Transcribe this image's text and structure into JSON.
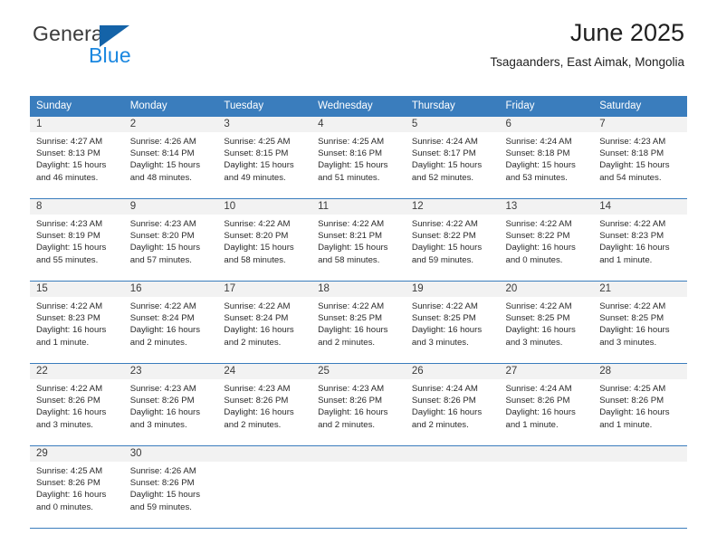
{
  "brand": {
    "name_top": "General",
    "name_bottom": "Blue",
    "triangle_color": "#1463a8",
    "blue_color": "#1a87e0"
  },
  "header": {
    "title": "June 2025",
    "subtitle": "Tsagaanders, East Aimak, Mongolia"
  },
  "theme": {
    "header_blue": "#3a7dbd",
    "daynum_band": "#f2f2f2",
    "text": "#2a2a2a"
  },
  "weekdays": [
    "Sunday",
    "Monday",
    "Tuesday",
    "Wednesday",
    "Thursday",
    "Friday",
    "Saturday"
  ],
  "weeks": [
    [
      {
        "day": "1",
        "sunrise": "Sunrise: 4:27 AM",
        "sunset": "Sunset: 8:13 PM",
        "daylight1": "Daylight: 15 hours",
        "daylight2": "and 46 minutes."
      },
      {
        "day": "2",
        "sunrise": "Sunrise: 4:26 AM",
        "sunset": "Sunset: 8:14 PM",
        "daylight1": "Daylight: 15 hours",
        "daylight2": "and 48 minutes."
      },
      {
        "day": "3",
        "sunrise": "Sunrise: 4:25 AM",
        "sunset": "Sunset: 8:15 PM",
        "daylight1": "Daylight: 15 hours",
        "daylight2": "and 49 minutes."
      },
      {
        "day": "4",
        "sunrise": "Sunrise: 4:25 AM",
        "sunset": "Sunset: 8:16 PM",
        "daylight1": "Daylight: 15 hours",
        "daylight2": "and 51 minutes."
      },
      {
        "day": "5",
        "sunrise": "Sunrise: 4:24 AM",
        "sunset": "Sunset: 8:17 PM",
        "daylight1": "Daylight: 15 hours",
        "daylight2": "and 52 minutes."
      },
      {
        "day": "6",
        "sunrise": "Sunrise: 4:24 AM",
        "sunset": "Sunset: 8:18 PM",
        "daylight1": "Daylight: 15 hours",
        "daylight2": "and 53 minutes."
      },
      {
        "day": "7",
        "sunrise": "Sunrise: 4:23 AM",
        "sunset": "Sunset: 8:18 PM",
        "daylight1": "Daylight: 15 hours",
        "daylight2": "and 54 minutes."
      }
    ],
    [
      {
        "day": "8",
        "sunrise": "Sunrise: 4:23 AM",
        "sunset": "Sunset: 8:19 PM",
        "daylight1": "Daylight: 15 hours",
        "daylight2": "and 55 minutes."
      },
      {
        "day": "9",
        "sunrise": "Sunrise: 4:23 AM",
        "sunset": "Sunset: 8:20 PM",
        "daylight1": "Daylight: 15 hours",
        "daylight2": "and 57 minutes."
      },
      {
        "day": "10",
        "sunrise": "Sunrise: 4:22 AM",
        "sunset": "Sunset: 8:20 PM",
        "daylight1": "Daylight: 15 hours",
        "daylight2": "and 58 minutes."
      },
      {
        "day": "11",
        "sunrise": "Sunrise: 4:22 AM",
        "sunset": "Sunset: 8:21 PM",
        "daylight1": "Daylight: 15 hours",
        "daylight2": "and 58 minutes."
      },
      {
        "day": "12",
        "sunrise": "Sunrise: 4:22 AM",
        "sunset": "Sunset: 8:22 PM",
        "daylight1": "Daylight: 15 hours",
        "daylight2": "and 59 minutes."
      },
      {
        "day": "13",
        "sunrise": "Sunrise: 4:22 AM",
        "sunset": "Sunset: 8:22 PM",
        "daylight1": "Daylight: 16 hours",
        "daylight2": "and 0 minutes."
      },
      {
        "day": "14",
        "sunrise": "Sunrise: 4:22 AM",
        "sunset": "Sunset: 8:23 PM",
        "daylight1": "Daylight: 16 hours",
        "daylight2": "and 1 minute."
      }
    ],
    [
      {
        "day": "15",
        "sunrise": "Sunrise: 4:22 AM",
        "sunset": "Sunset: 8:23 PM",
        "daylight1": "Daylight: 16 hours",
        "daylight2": "and 1 minute."
      },
      {
        "day": "16",
        "sunrise": "Sunrise: 4:22 AM",
        "sunset": "Sunset: 8:24 PM",
        "daylight1": "Daylight: 16 hours",
        "daylight2": "and 2 minutes."
      },
      {
        "day": "17",
        "sunrise": "Sunrise: 4:22 AM",
        "sunset": "Sunset: 8:24 PM",
        "daylight1": "Daylight: 16 hours",
        "daylight2": "and 2 minutes."
      },
      {
        "day": "18",
        "sunrise": "Sunrise: 4:22 AM",
        "sunset": "Sunset: 8:25 PM",
        "daylight1": "Daylight: 16 hours",
        "daylight2": "and 2 minutes."
      },
      {
        "day": "19",
        "sunrise": "Sunrise: 4:22 AM",
        "sunset": "Sunset: 8:25 PM",
        "daylight1": "Daylight: 16 hours",
        "daylight2": "and 3 minutes."
      },
      {
        "day": "20",
        "sunrise": "Sunrise: 4:22 AM",
        "sunset": "Sunset: 8:25 PM",
        "daylight1": "Daylight: 16 hours",
        "daylight2": "and 3 minutes."
      },
      {
        "day": "21",
        "sunrise": "Sunrise: 4:22 AM",
        "sunset": "Sunset: 8:25 PM",
        "daylight1": "Daylight: 16 hours",
        "daylight2": "and 3 minutes."
      }
    ],
    [
      {
        "day": "22",
        "sunrise": "Sunrise: 4:22 AM",
        "sunset": "Sunset: 8:26 PM",
        "daylight1": "Daylight: 16 hours",
        "daylight2": "and 3 minutes."
      },
      {
        "day": "23",
        "sunrise": "Sunrise: 4:23 AM",
        "sunset": "Sunset: 8:26 PM",
        "daylight1": "Daylight: 16 hours",
        "daylight2": "and 3 minutes."
      },
      {
        "day": "24",
        "sunrise": "Sunrise: 4:23 AM",
        "sunset": "Sunset: 8:26 PM",
        "daylight1": "Daylight: 16 hours",
        "daylight2": "and 2 minutes."
      },
      {
        "day": "25",
        "sunrise": "Sunrise: 4:23 AM",
        "sunset": "Sunset: 8:26 PM",
        "daylight1": "Daylight: 16 hours",
        "daylight2": "and 2 minutes."
      },
      {
        "day": "26",
        "sunrise": "Sunrise: 4:24 AM",
        "sunset": "Sunset: 8:26 PM",
        "daylight1": "Daylight: 16 hours",
        "daylight2": "and 2 minutes."
      },
      {
        "day": "27",
        "sunrise": "Sunrise: 4:24 AM",
        "sunset": "Sunset: 8:26 PM",
        "daylight1": "Daylight: 16 hours",
        "daylight2": "and 1 minute."
      },
      {
        "day": "28",
        "sunrise": "Sunrise: 4:25 AM",
        "sunset": "Sunset: 8:26 PM",
        "daylight1": "Daylight: 16 hours",
        "daylight2": "and 1 minute."
      }
    ],
    [
      {
        "day": "29",
        "sunrise": "Sunrise: 4:25 AM",
        "sunset": "Sunset: 8:26 PM",
        "daylight1": "Daylight: 16 hours",
        "daylight2": "and 0 minutes."
      },
      {
        "day": "30",
        "sunrise": "Sunrise: 4:26 AM",
        "sunset": "Sunset: 8:26 PM",
        "daylight1": "Daylight: 15 hours",
        "daylight2": "and 59 minutes."
      },
      {
        "day": "",
        "sunrise": "",
        "sunset": "",
        "daylight1": "",
        "daylight2": ""
      },
      {
        "day": "",
        "sunrise": "",
        "sunset": "",
        "daylight1": "",
        "daylight2": ""
      },
      {
        "day": "",
        "sunrise": "",
        "sunset": "",
        "daylight1": "",
        "daylight2": ""
      },
      {
        "day": "",
        "sunrise": "",
        "sunset": "",
        "daylight1": "",
        "daylight2": ""
      },
      {
        "day": "",
        "sunrise": "",
        "sunset": "",
        "daylight1": "",
        "daylight2": ""
      }
    ]
  ]
}
